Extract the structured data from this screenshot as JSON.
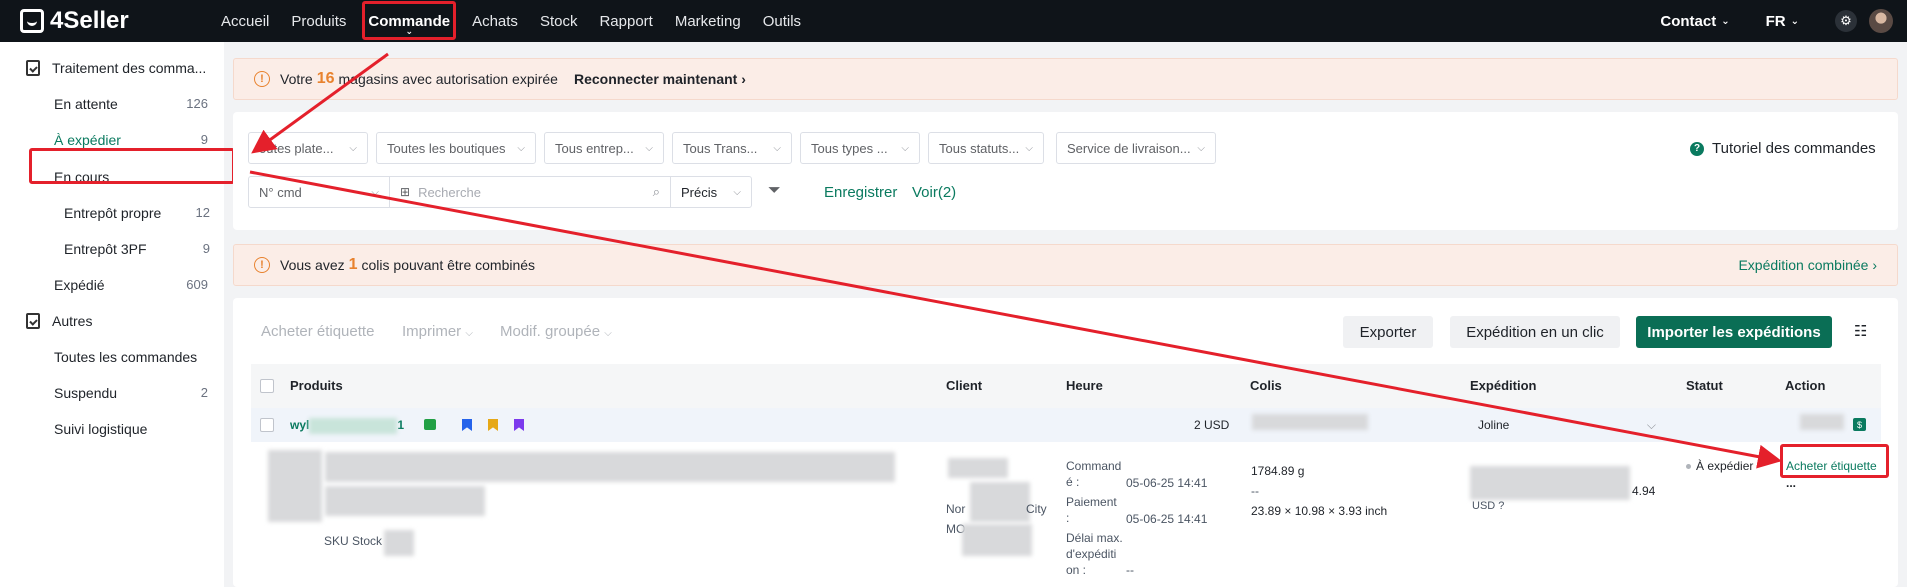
{
  "brand": {
    "name": "4Seller"
  },
  "nav": [
    {
      "label": "Accueil"
    },
    {
      "label": "Produits"
    },
    {
      "label": "Commande"
    },
    {
      "label": "Achats"
    },
    {
      "label": "Stock"
    },
    {
      "label": "Rapport"
    },
    {
      "label": "Marketing"
    },
    {
      "label": "Outils"
    }
  ],
  "topright": {
    "contact": "Contact",
    "lang": "FR"
  },
  "sidebar": {
    "group1": "Traitement des comma...",
    "items": [
      {
        "label": "En attente",
        "count": "126"
      },
      {
        "label": "À expédier",
        "count": "9"
      },
      {
        "label": "En cours",
        "count": ""
      },
      {
        "label": "Entrepôt propre",
        "count": "12"
      },
      {
        "label": "Entrepôt 3PF",
        "count": "9"
      },
      {
        "label": "Expédié",
        "count": "609"
      }
    ],
    "group2": "Autres",
    "items2": [
      {
        "label": "Toutes les commandes",
        "count": ""
      },
      {
        "label": "Suspendu",
        "count": "2"
      },
      {
        "label": "Suivi logistique",
        "count": ""
      }
    ]
  },
  "banner1": {
    "pre": "Votre",
    "num": "16",
    "post": "magasins avec autorisation expirée",
    "link": "Reconnecter maintenant"
  },
  "filters": [
    "outes plate...",
    "Toutes les boutiques",
    "Tous entrep...",
    "Tous Trans...",
    "Tous types ...",
    "Tous statuts...",
    "Service de livraison..."
  ],
  "tutorial": "Tutoriel des commandes",
  "search": {
    "field": "N° cmd",
    "placeholder": "Recherche",
    "mode": "Précis",
    "save": "Enregistrer",
    "view": "Voir(2)"
  },
  "banner2": {
    "pre": "Vous avez",
    "num": "1",
    "post": "colis pouvant être combinés",
    "link": "Expédition combinée"
  },
  "toolbar": {
    "buy": "Acheter étiquette",
    "print": "Imprimer",
    "bulk": "Modif. groupée",
    "export": "Exporter",
    "oneclick": "Expédition en un clic",
    "import": "Importer les expéditions"
  },
  "table": {
    "headers": [
      "Produits",
      "Client",
      "Heure",
      "Colis",
      "Expédition",
      "Statut",
      "Action"
    ],
    "order": {
      "id_prefix": "wyl",
      "id_suffix": "1",
      "amount": "2 USD",
      "carrier": "Joline"
    },
    "row": {
      "sku": "SKU Stock",
      "client_line2a": "Nor",
      "client_line2b": "City",
      "client_line3": "MO",
      "time": [
        {
          "label": "Command\né :",
          "value": "05-06-25 14:41"
        },
        {
          "label": "Paiement\n:",
          "value": "05-06-25 14:41"
        },
        {
          "label": "Délai max.\nd'expéditi\non :",
          "value": "--"
        }
      ],
      "weight": "1784.89 g",
      "dash": "--",
      "dims": "23.89 × 10.98 × 3.93 inch",
      "shipping_price": "4.94",
      "shipping_cur": "USD ?",
      "status": "À expédier",
      "action": "Acheter étiquette",
      "more": "..."
    }
  },
  "colors": {
    "accent": "#0a6e55",
    "warning": "#e8822e",
    "annotation": "#e4202b"
  }
}
